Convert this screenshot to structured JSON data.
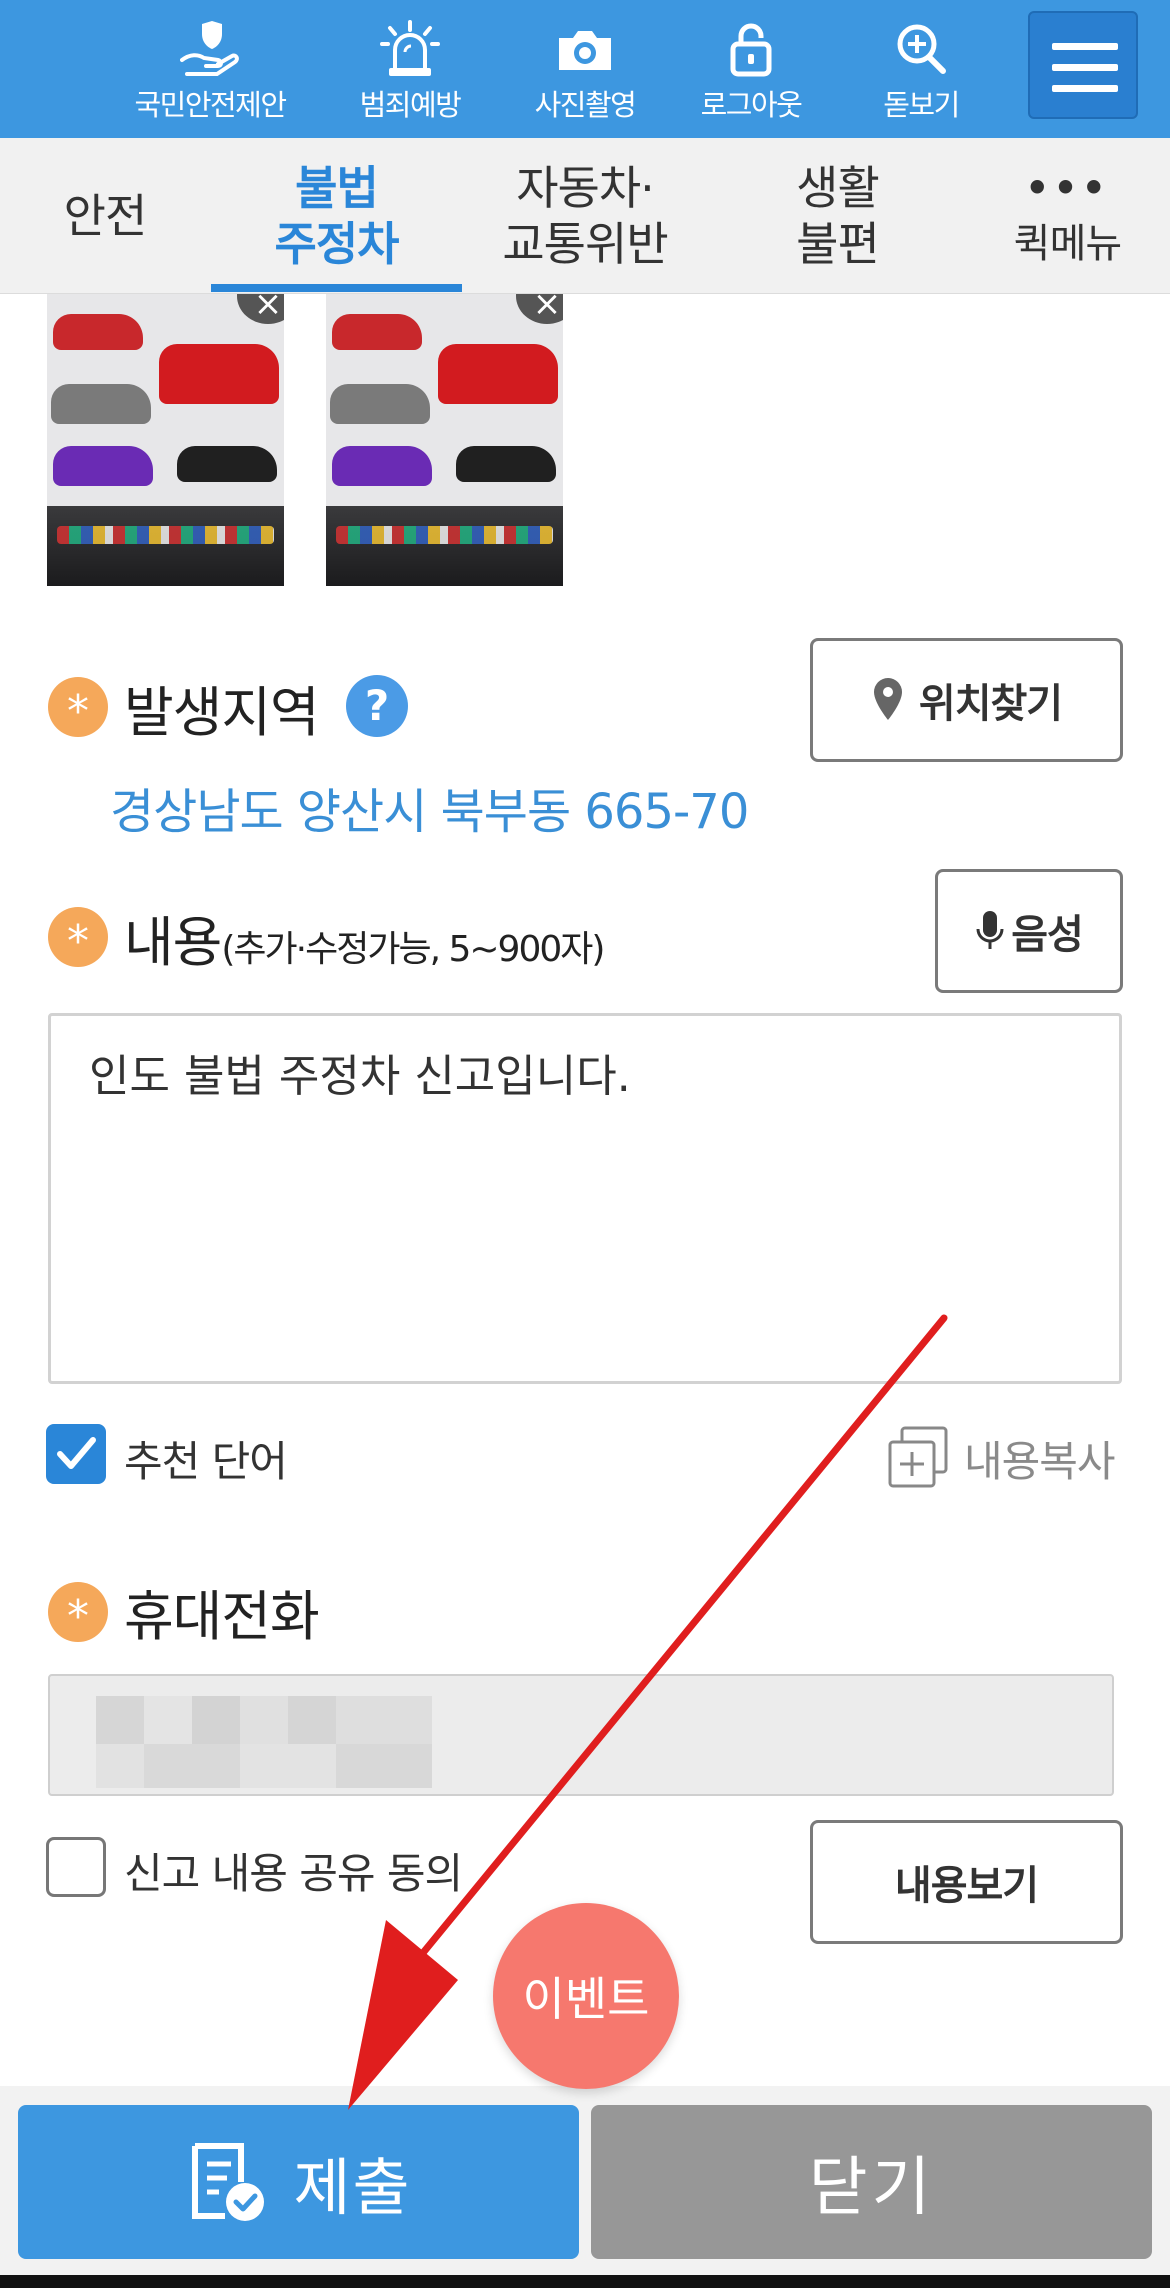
{
  "colors": {
    "primary": "#3d97e0",
    "accent_text": "#3a8fd6",
    "required_marker": "#f5a85a",
    "close_button": "#979797",
    "event_badge": "#f6786e",
    "annotation_arrow": "#e01e1e"
  },
  "toolbar": {
    "items": [
      {
        "icon": "hand-shield-icon",
        "label": "국민안전제안"
      },
      {
        "icon": "siren-icon",
        "label": "범죄예방"
      },
      {
        "icon": "camera-icon",
        "label": "사진촬영"
      },
      {
        "icon": "unlock-icon",
        "label": "로그아웃"
      },
      {
        "icon": "magnifier-plus-icon",
        "label": "돋보기"
      }
    ],
    "menu_icon": "hamburger-menu-icon"
  },
  "tabs": [
    {
      "line1": "안전",
      "line2": ""
    },
    {
      "line1": "불법",
      "line2": "주정차",
      "active": true
    },
    {
      "line1": "자동차·",
      "line2": "교통위반"
    },
    {
      "line1": "생활",
      "line2": "불편"
    },
    {
      "line1": "•••",
      "line2": "퀵메뉴"
    }
  ],
  "location": {
    "label": "발생지역",
    "help": "?",
    "find_button": "위치찾기",
    "address": "경상남도 양산시 북부동 665-70"
  },
  "content": {
    "label": "내용",
    "hint": "(추가·수정가능, 5~900자)",
    "voice_button": "음성",
    "text": "인도 불법 주정차 신고입니다."
  },
  "recommend": {
    "label": "추천 단어",
    "checked": true
  },
  "copy": {
    "label": "내용복사"
  },
  "phone": {
    "label": "휴대전화"
  },
  "share": {
    "label": "신고 내용 공유 동의",
    "checked": false,
    "view_button": "내용보기"
  },
  "event": {
    "label": "이벤트"
  },
  "actions": {
    "submit": "제출",
    "close": "닫기"
  }
}
